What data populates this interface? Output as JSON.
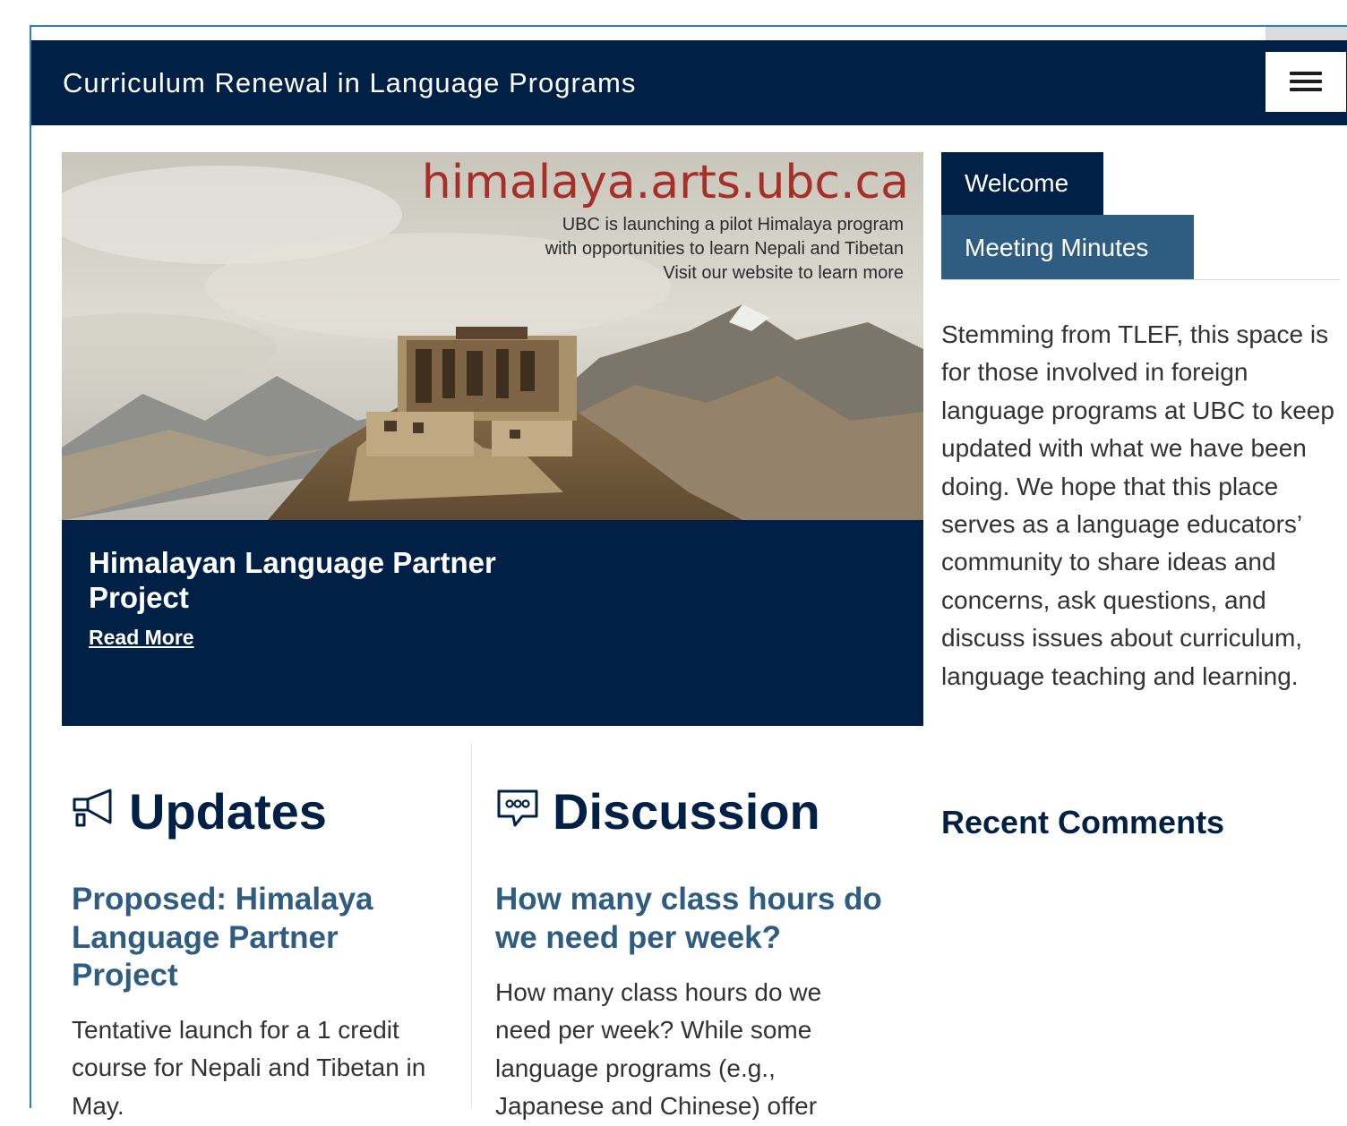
{
  "header": {
    "site_title": "Curriculum Renewal in Language Programs",
    "menu_icon": "hamburger-menu-icon",
    "background_color": "#002145"
  },
  "hero": {
    "image_domain_text": "himalaya.arts.ubc.ca",
    "image_lines": [
      "UBC is launching a pilot Himalaya program",
      "with opportunities to learn Nepali and Tibetan",
      "Visit our website to learn more"
    ],
    "title": "Himalayan Language Partner Project",
    "read_more": "Read More"
  },
  "sidebar": {
    "tabs": [
      {
        "label": "Welcome",
        "active": true
      },
      {
        "label": "Meeting Minutes",
        "active": false
      }
    ],
    "welcome_text": "Stemming from TLEF, this space is for those involved in foreign language programs at UBC to keep updated with what we have been doing. We hope that this place serves as a language educators’ community to share ideas and concerns, ask questions, and discuss issues about curriculum, language teaching and learning.",
    "recent_comments_heading": "Recent Comments"
  },
  "updates": {
    "heading": "Updates",
    "icon": "megaphone-icon",
    "post_title": "Proposed: Himalaya Language Partner Project",
    "post_excerpt": "Tentative launch for a 1 credit course for Nepali and Tibetan in May."
  },
  "discussion": {
    "heading": "Discussion",
    "icon": "speech-bubble-icon",
    "post_title": "How many class hours do we need per week?",
    "post_excerpt": "How many class hours do we need per week? While some language programs (e.g., Japanese and Chinese) offer"
  },
  "colors": {
    "navy": "#002145",
    "link_blue": "#2f5d82",
    "hero_domain_red": "#a63028"
  }
}
